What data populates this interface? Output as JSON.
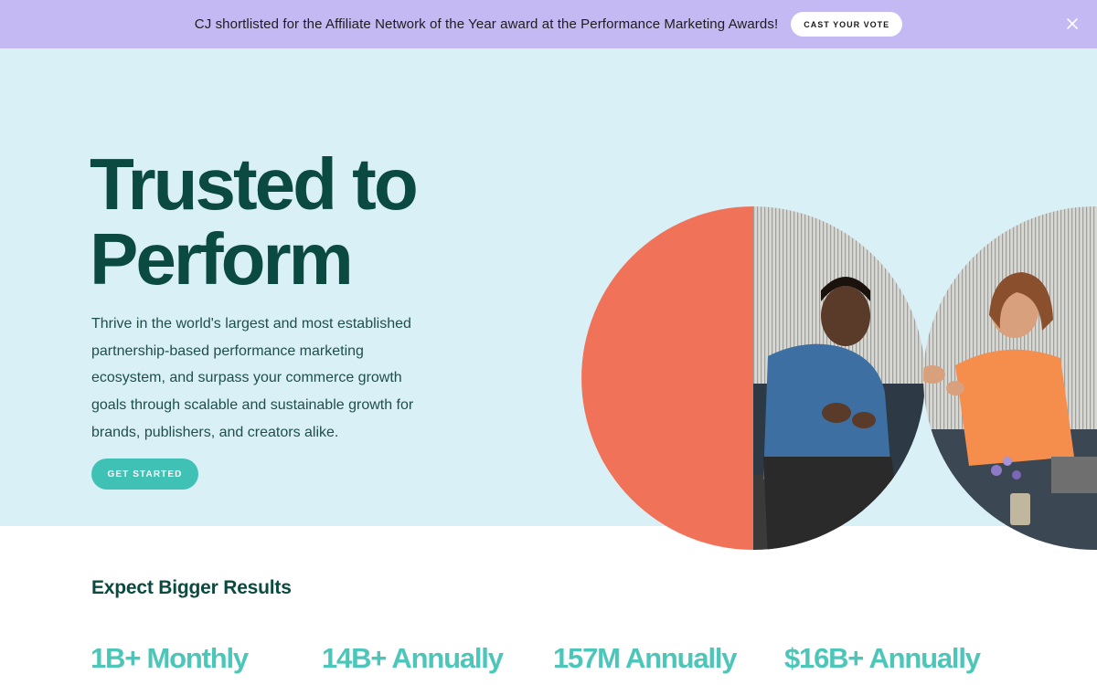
{
  "banner": {
    "text": "CJ shortlisted for the Affiliate Network of the Year award at the Performance Marketing Awards!",
    "cta_label": "CAST YOUR VOTE",
    "close_icon": "close-icon"
  },
  "hero": {
    "title_line1": "Trusted to",
    "title_line2": "Perform",
    "description": "Thrive in the world's largest and most established partnership-based performance marketing ecosystem, and surpass your commerce growth goals through scalable and sustainable growth for brands, publishers, and creators alike.",
    "cta_label": "GET STARTED"
  },
  "results": {
    "title": "Expect Bigger Results",
    "stats": [
      "1B+ Monthly",
      "14B+ Annually",
      "157M Annually",
      "$16B+ Annually"
    ]
  },
  "colors": {
    "banner_bg": "#c5b9f3",
    "hero_bg": "#d9f0f7",
    "brand_dark_green": "#0b4a40",
    "accent_teal": "#3fc1b5",
    "coral": "#f07259"
  }
}
